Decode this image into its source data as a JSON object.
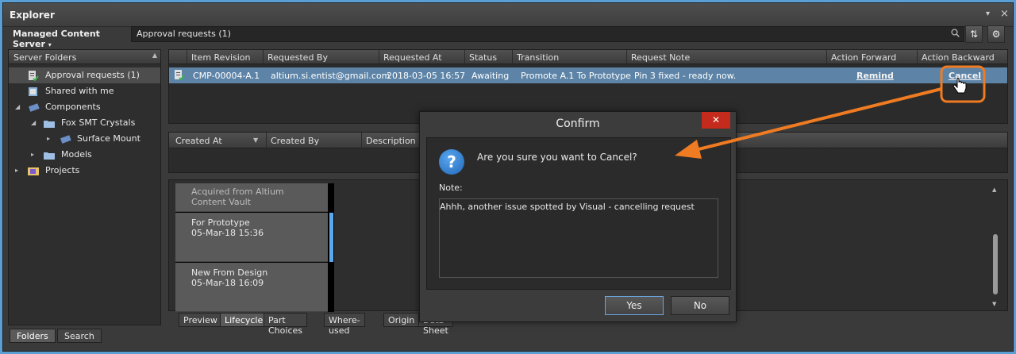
{
  "window": {
    "title": "Explorer",
    "pin_icon": "▾",
    "close_icon": "×"
  },
  "pathbar": {
    "server": "Managed Content Server",
    "server_arrow": "▾",
    "path": "Approval requests (1)",
    "search_icon": "search-icon",
    "refresh_icon": "⇅",
    "settings_icon": "⚙"
  },
  "folders": {
    "header": "Server Folders",
    "items": [
      {
        "label": "Approval requests (1)",
        "selected": true,
        "icon": "approval-icon"
      },
      {
        "label": "Shared with me",
        "icon": "shared-icon"
      },
      {
        "label": "Components",
        "icon": "components-icon"
      },
      {
        "label": "Fox SMT Crystals",
        "icon": "folder-icon"
      },
      {
        "label": "Surface Mount",
        "icon": "component-icon"
      },
      {
        "label": "Models",
        "icon": "folder-icon"
      },
      {
        "label": "Projects",
        "icon": "projects-icon"
      }
    ]
  },
  "bottom_tabs": [
    "Folders",
    "Search"
  ],
  "grid": {
    "columns": [
      "Item Revision",
      "Requested By",
      "Requested At",
      "Status",
      "Transition",
      "Request Note",
      "Action Forward",
      "Action Backward"
    ],
    "row": {
      "item_revision": "CMP-00004-A.1",
      "requested_by": "altium.si.entist@gmail.com",
      "requested_at": "2018-03-05 16:57",
      "status": "Awaiting",
      "transition": "Promote A.1 To Prototype",
      "request_note": "Pin 3 fixed - ready now.",
      "action_forward": "Remind",
      "action_backward": "Cancel"
    }
  },
  "detail": {
    "columns": [
      "Created At",
      "Created By",
      "Description"
    ]
  },
  "lifecycle": {
    "cards": [
      {
        "title": "Acquired from Altium Content Vault",
        "date": ""
      },
      {
        "title": "For Prototype",
        "date": "05-Mar-18 15:36"
      },
      {
        "title": "New From Design",
        "date": "05-Mar-18 16:09"
      }
    ],
    "tabs": [
      "Preview",
      "Lifecycle",
      "Part Choices",
      "Where-used",
      "Origin",
      "Data Sheet"
    ],
    "active_tab": "Lifecycle"
  },
  "dialog": {
    "title": "Confirm",
    "close_label": "✕",
    "question": "Are you sure you want to Cancel?",
    "note_label": "Note:",
    "note_value": "Ahhh, another issue spotted by Visual - cancelling request",
    "yes_label": "Yes",
    "no_label": "No"
  },
  "colors": {
    "accent": "#ef7b22",
    "selection": "#5d84a7",
    "lifecycle_marker": "#5ba8ef"
  }
}
